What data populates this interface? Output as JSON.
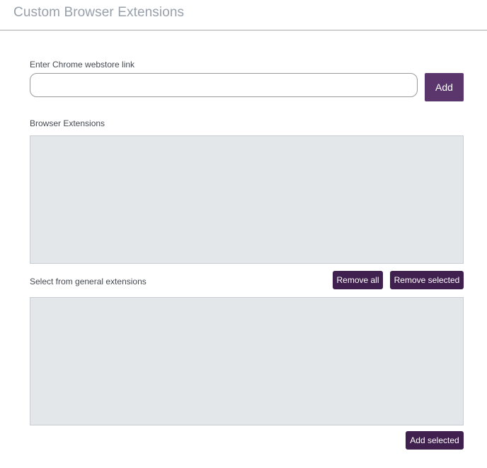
{
  "header": {
    "title": "Custom Browser Extensions"
  },
  "webstore": {
    "label": "Enter Chrome webstore link",
    "input_value": "",
    "placeholder": "",
    "add_label": "Add"
  },
  "browser_extensions": {
    "label": "Browser Extensions",
    "items": []
  },
  "general_extensions": {
    "label": "Select from general extensions",
    "remove_all_label": "Remove all",
    "remove_selected_label": "Remove selected",
    "add_selected_label": "Add selected",
    "items": []
  },
  "colors": {
    "primary_button": "#5b366d",
    "secondary_button": "#40204f",
    "listbox_bg": "#e4e7ea",
    "title_text": "#98a0ab"
  }
}
